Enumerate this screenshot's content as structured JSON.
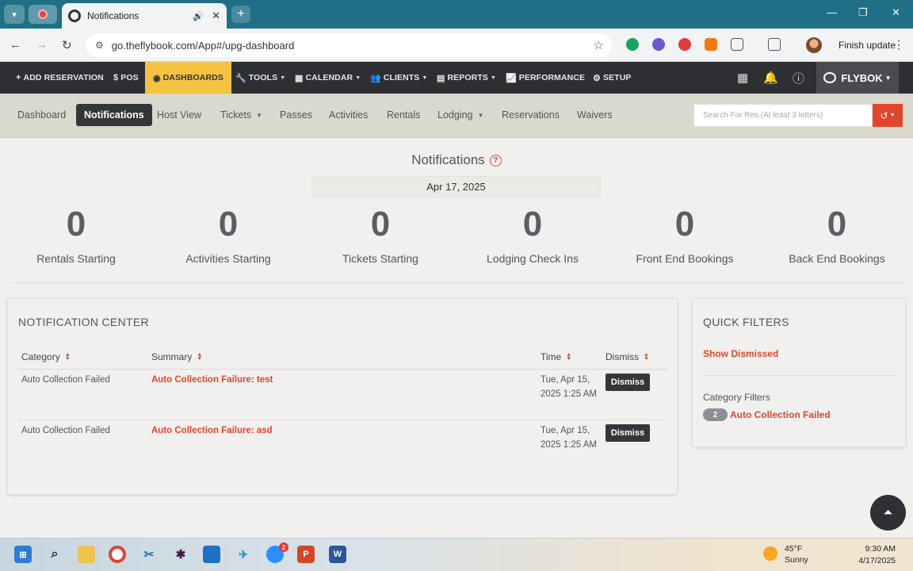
{
  "browser": {
    "tab_title": "Notifications",
    "url": "go.theflybook.com/App#/upg-dashboard",
    "finish_update": "Finish update"
  },
  "app_nav": {
    "items": [
      {
        "label": "ADD RESERVATION",
        "icon": "plus-icon"
      },
      {
        "label": "POS",
        "icon": "dollar-icon"
      },
      {
        "label": "DASHBOARDS",
        "icon": "dashboard-icon"
      },
      {
        "label": "TOOLS",
        "icon": "wrench-icon"
      },
      {
        "label": "CALENDAR",
        "icon": "calendar-icon"
      },
      {
        "label": "CLIENTS",
        "icon": "users-icon"
      },
      {
        "label": "REPORTS",
        "icon": "reports-icon"
      },
      {
        "label": "PERFORMANCE",
        "icon": "chart-icon"
      },
      {
        "label": "SETUP",
        "icon": "gear-icon"
      }
    ],
    "brand": "FLYBOK"
  },
  "sub_nav": {
    "items": [
      "Dashboard",
      "Notifications",
      "Host View",
      "Tickets",
      "Passes",
      "Activities",
      "Rentals",
      "Lodging",
      "Reservations",
      "Waivers"
    ],
    "search_placeholder": "Search For Res.(At least 3 letters)"
  },
  "page": {
    "title": "Notifications",
    "date": "Apr 17, 2025"
  },
  "stats": [
    {
      "value": "0",
      "label": "Rentals Starting"
    },
    {
      "value": "0",
      "label": "Activities Starting"
    },
    {
      "value": "0",
      "label": "Tickets Starting"
    },
    {
      "value": "0",
      "label": "Lodging Check Ins"
    },
    {
      "value": "0",
      "label": "Front End Bookings"
    },
    {
      "value": "0",
      "label": "Back End Bookings"
    }
  ],
  "notification_center": {
    "title": "NOTIFICATION CENTER",
    "columns": [
      "Category",
      "Summary",
      "Time",
      "Dismiss"
    ],
    "rows": [
      {
        "category": "Auto Collection Failed",
        "summary": "Auto Collection Failure: test",
        "time": "Tue, Apr 15, 2025 1:25 AM",
        "action": "Dismiss"
      },
      {
        "category": "Auto Collection Failed",
        "summary": "Auto Collection Failure: asd",
        "time": "Tue, Apr 15, 2025 1:25 AM",
        "action": "Dismiss"
      }
    ]
  },
  "quick_filters": {
    "title": "QUICK FILTERS",
    "show_dismissed": "Show Dismissed",
    "category_filters_label": "Category Filters",
    "categories": [
      {
        "count": "2",
        "label": "Auto Collection Failed"
      }
    ]
  },
  "taskbar": {
    "weather_temp": "45°F",
    "weather_desc": "Sunny",
    "time": "9:30 AM",
    "date": "4/17/2025",
    "zoom_badge": "2"
  },
  "colors": {
    "accent": "#e1462d",
    "nav_bg": "#2e2f33",
    "nav_active": "#f5c342",
    "subnav_bg": "#d9d9cd",
    "browser_chrome": "#1f6f87"
  }
}
